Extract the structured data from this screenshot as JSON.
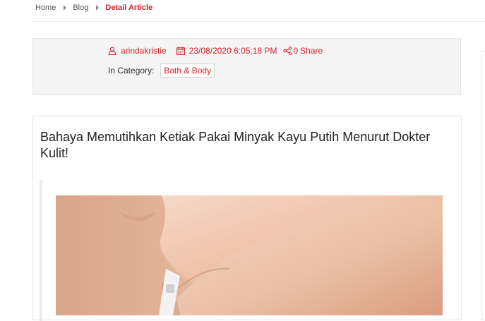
{
  "breadcrumb": {
    "items": [
      "Home",
      "Blog"
    ],
    "current": "Detail Article"
  },
  "meta": {
    "author": "arindakristie",
    "datetime": "23/08/2020 6:05:18 PM",
    "share_count": "0",
    "share_label": "Share",
    "category_label": "In Category:",
    "category": "Bath & Body"
  },
  "article": {
    "title": "Bahaya Memutihkan Ketiak Pakai Minyak Kayu Putih Menurut Dokter Kulit!"
  },
  "colors": {
    "accent": "#d2232a",
    "meta_bg": "#f4f4f4",
    "border": "#e4e4e4"
  },
  "icons": [
    "user-icon",
    "calendar-icon",
    "share-icon",
    "chevron-right-icon"
  ]
}
